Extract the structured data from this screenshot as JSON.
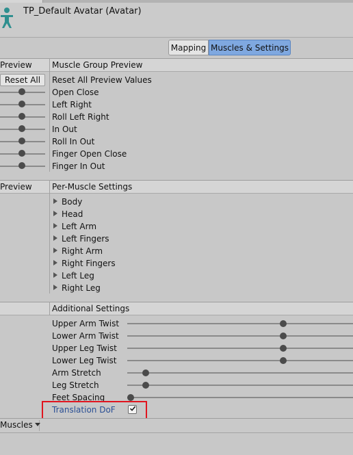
{
  "header": {
    "title": "TP_Default Avatar (Avatar)",
    "icon": "avatar-person-icon"
  },
  "toolbar": {
    "tabs": [
      {
        "label": "Mapping"
      },
      {
        "label": "Muscles & Settings"
      }
    ],
    "selected": "Muscles & Settings"
  },
  "muscle_group_preview": {
    "left_header": "Preview",
    "right_header": "Muscle Group Preview",
    "reset_button": "Reset All",
    "reset_label": "Reset All Preview Values",
    "rows": [
      "Open Close",
      "Left Right",
      "Roll Left Right",
      "In Out",
      "Roll In Out",
      "Finger Open Close",
      "Finger In Out"
    ]
  },
  "per_muscle_settings": {
    "left_header": "Preview",
    "right_header": "Per-Muscle Settings",
    "items": [
      "Body",
      "Head",
      "Left Arm",
      "Left Fingers",
      "Right Arm",
      "Right Fingers",
      "Left Leg",
      "Right Leg"
    ]
  },
  "additional_settings": {
    "header": "Additional Settings",
    "sliders": [
      {
        "label": "Upper Arm Twist",
        "value": 0.5
      },
      {
        "label": "Lower Arm Twist",
        "value": 0.5
      },
      {
        "label": "Upper Leg Twist",
        "value": 0.5
      },
      {
        "label": "Lower Leg Twist",
        "value": 0.5
      },
      {
        "label": "Arm Stretch",
        "value": 0.05
      },
      {
        "label": "Leg Stretch",
        "value": 0.05
      },
      {
        "label": "Feet Spacing",
        "value": 0.0
      }
    ],
    "translation_dof": {
      "label": "Translation DoF",
      "checked": true
    }
  },
  "footer": {
    "dropdown_label": "Muscles"
  },
  "colors": {
    "selected_tab": "#7fa8e0",
    "highlight": "#e0141e",
    "link_label": "#2a4f94"
  }
}
